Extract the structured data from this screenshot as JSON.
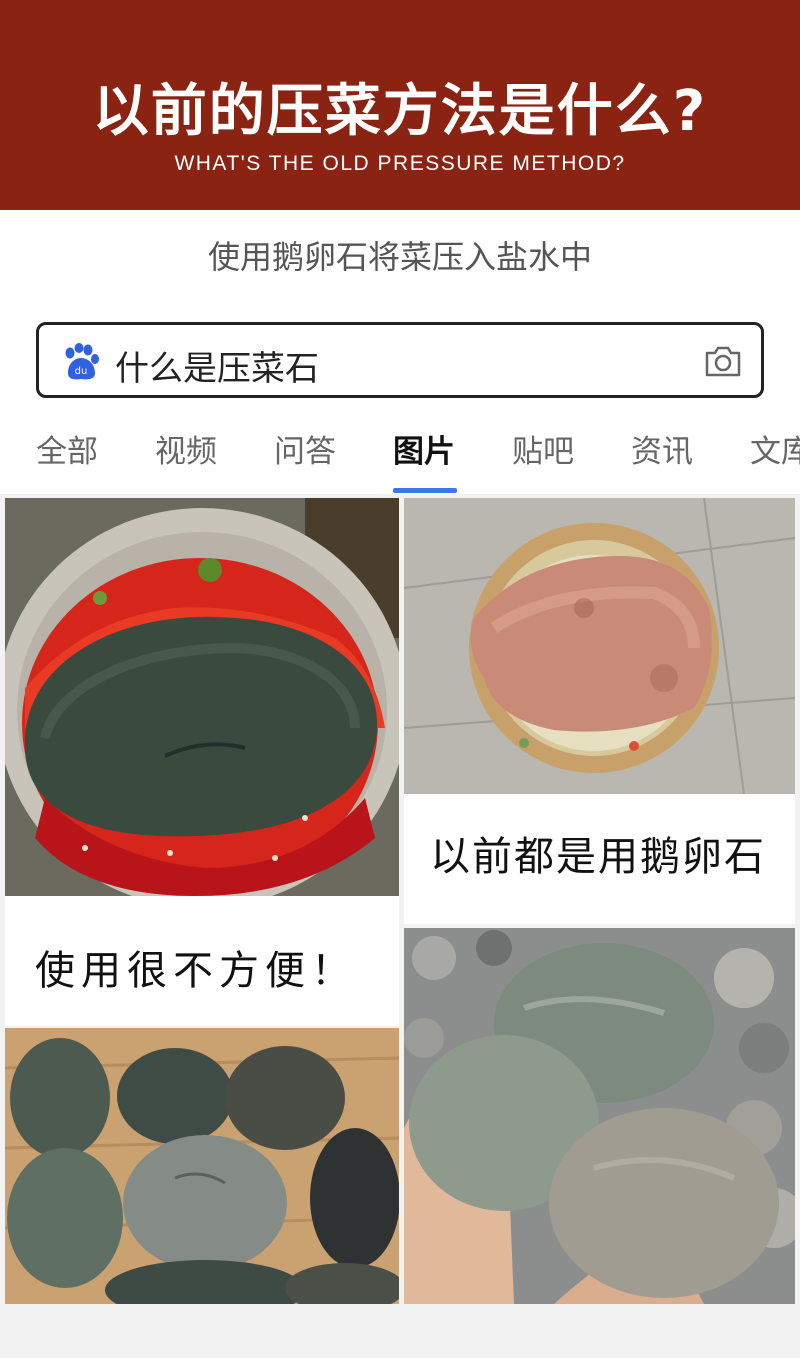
{
  "banner": {
    "title": "以前的压菜方法是什么?",
    "subtitle": "WHAT'S THE OLD PRESSURE METHOD?",
    "background": "#8a2312"
  },
  "intro": {
    "text": "使用鹅卵石将菜压入盐水中"
  },
  "search": {
    "query": "什么是压菜石",
    "left_icon": "baidu-paw-icon",
    "right_icon": "camera-icon"
  },
  "tabs": [
    {
      "label": "全部",
      "active": false
    },
    {
      "label": "视频",
      "active": false
    },
    {
      "label": "问答",
      "active": false
    },
    {
      "label": "图片",
      "active": true
    },
    {
      "label": "贴吧",
      "active": false
    },
    {
      "label": "资讯",
      "active": false
    },
    {
      "label": "文库",
      "active": false
    }
  ],
  "accent_color": "#3b78e7",
  "results": {
    "caption_left": "使用很不方便！",
    "caption_right": "以前都是用鹅卵石",
    "images": [
      "pickle-jar-with-stone",
      "clay-pot-with-stone",
      "pebbles-on-wood",
      "hand-holding-pebbles"
    ]
  }
}
